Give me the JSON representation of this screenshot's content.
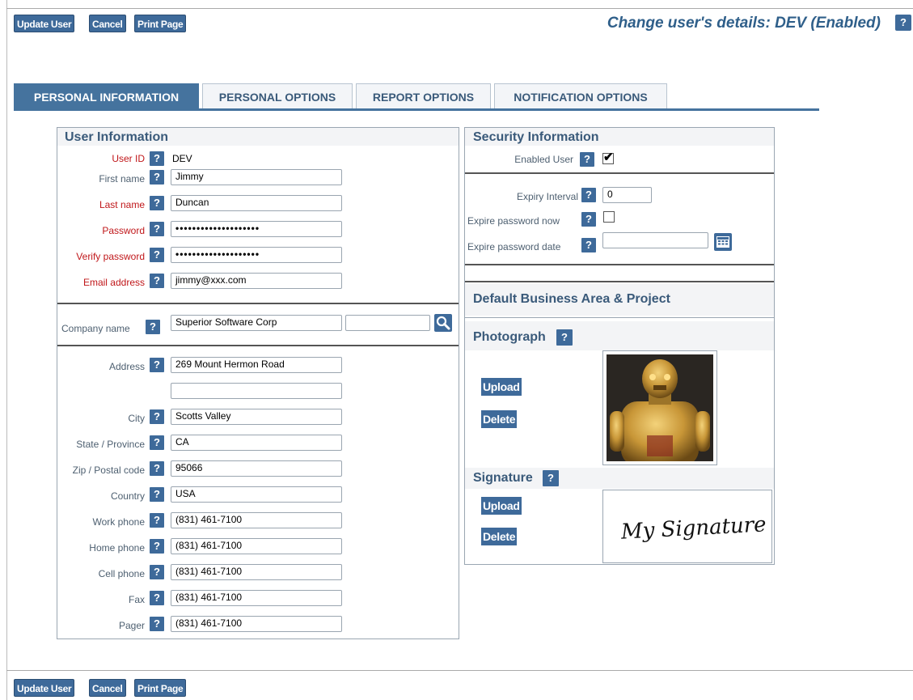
{
  "toolbar": {
    "update": "Update User",
    "cancel": "Cancel",
    "print": "Print Page"
  },
  "title": "Change user's details: DEV (Enabled)",
  "help": "?",
  "tabs": [
    "PERSONAL INFORMATION",
    "PERSONAL OPTIONS",
    "REPORT OPTIONS",
    "NOTIFICATION OPTIONS"
  ],
  "user_info": {
    "heading": "User Information",
    "user_id_label": "User ID",
    "user_id": "DEV",
    "first_name_label": "First name",
    "first_name": "Jimmy",
    "last_name_label": "Last name",
    "last_name": "Duncan",
    "password_label": "Password",
    "password": "••••••••••••••••••••",
    "verify_label": "Verify password",
    "verify": "••••••••••••••••••••",
    "email_label": "Email address",
    "email": "jimmy@xxx.com",
    "company_label": "Company name",
    "company": "Superior Software Corp",
    "company_extra": "",
    "address_label": "Address",
    "address1": "269 Mount Hermon Road",
    "address2": "",
    "city_label": "City",
    "city": "Scotts Valley",
    "state_label": "State / Province",
    "state": "CA",
    "zip_label": "Zip / Postal code",
    "zip": "95066",
    "country_label": "Country",
    "country": "USA",
    "work_label": "Work phone",
    "work": "(831) 461-7100",
    "home_label": "Home phone",
    "home": "(831) 461-7100",
    "cell_label": "Cell phone",
    "cell": "(831) 461-7100",
    "fax_label": "Fax",
    "fax": "(831) 461-7100",
    "pager_label": "Pager",
    "pager": "(831) 461-7100"
  },
  "security": {
    "heading": "Security Information",
    "enabled_label": "Enabled User",
    "enabled": true,
    "expiry_label": "Expiry Interval",
    "expiry": "0",
    "expire_now_label": "Expire password now",
    "expire_now": false,
    "expire_date_label": "Expire password date",
    "expire_date": ""
  },
  "default_area": {
    "heading": "Default Business Area & Project"
  },
  "photo": {
    "heading": "Photograph",
    "upload": "Upload",
    "delete": "Delete"
  },
  "signature": {
    "heading": "Signature",
    "upload": "Upload",
    "delete": "Delete",
    "text": "My Signature"
  },
  "colors": {
    "accent": "#3e6a9a",
    "heading": "#3a5a7a",
    "required": "#c0171a",
    "title": "#2f5f8a"
  }
}
